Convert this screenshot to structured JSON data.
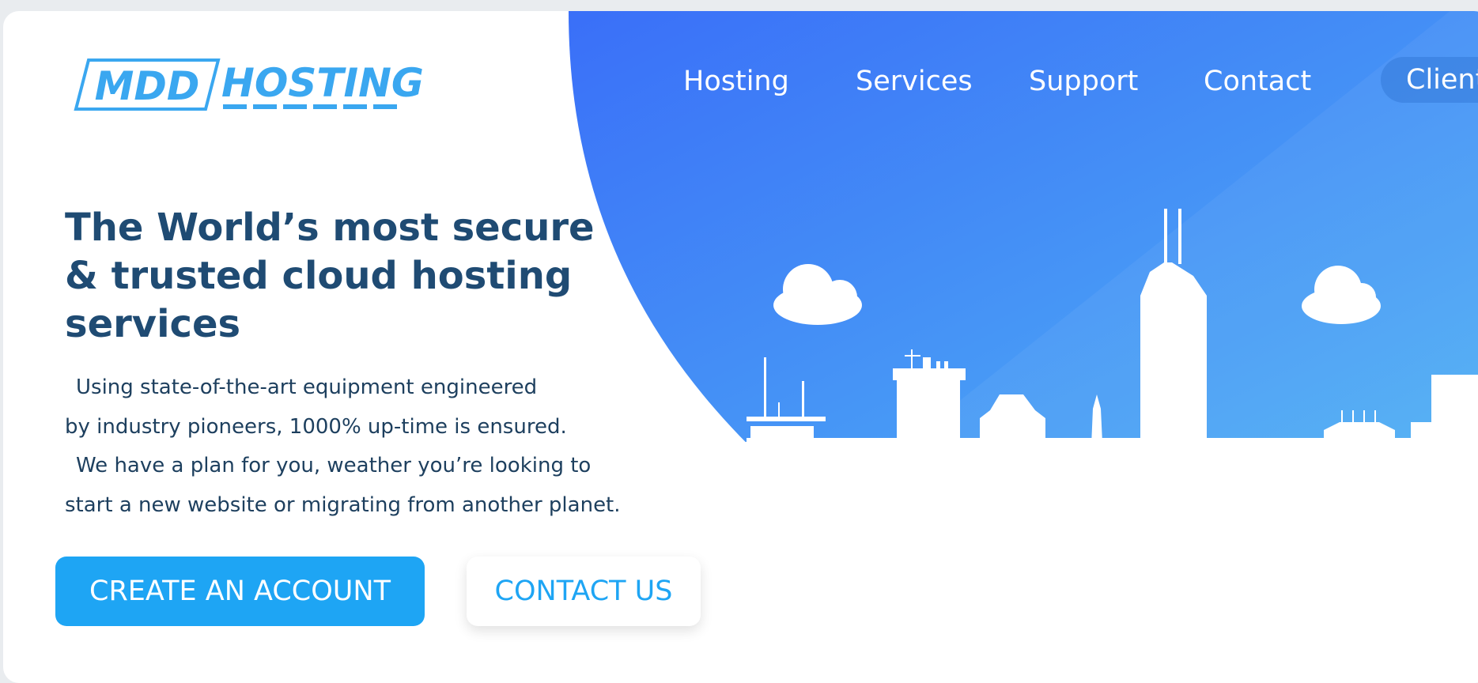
{
  "brand": {
    "logo_text_left": "MDD",
    "logo_text_right": "HOSTING",
    "logo_color": "#3aa7f0"
  },
  "nav": {
    "items": [
      {
        "label": "Hosting"
      },
      {
        "label": "Services"
      },
      {
        "label": "Support"
      },
      {
        "label": "Contact"
      }
    ],
    "client_label": "Client"
  },
  "hero": {
    "headline_lines": [
      "The World’s most secure",
      "& trusted cloud hosting",
      "services"
    ],
    "description_lines": [
      "Using state-of-the-art equipment engineered",
      "by industry pioneers, 1000% up-time is ensured.",
      "We have a plan for you, weather you’re looking to",
      "start a new website or migrating from another planet."
    ],
    "primary_button": "CREATE AN ACCOUNT",
    "secondary_button": "CONTACT US"
  },
  "colors": {
    "gradient_start": "#3a6ff8",
    "gradient_end": "#4fb1f4",
    "headline": "#1f4b73",
    "accent": "#1ea5f4"
  },
  "illustration": {
    "icons": [
      "cloud-icon",
      "cloud-icon",
      "city-skyline-icon"
    ]
  }
}
